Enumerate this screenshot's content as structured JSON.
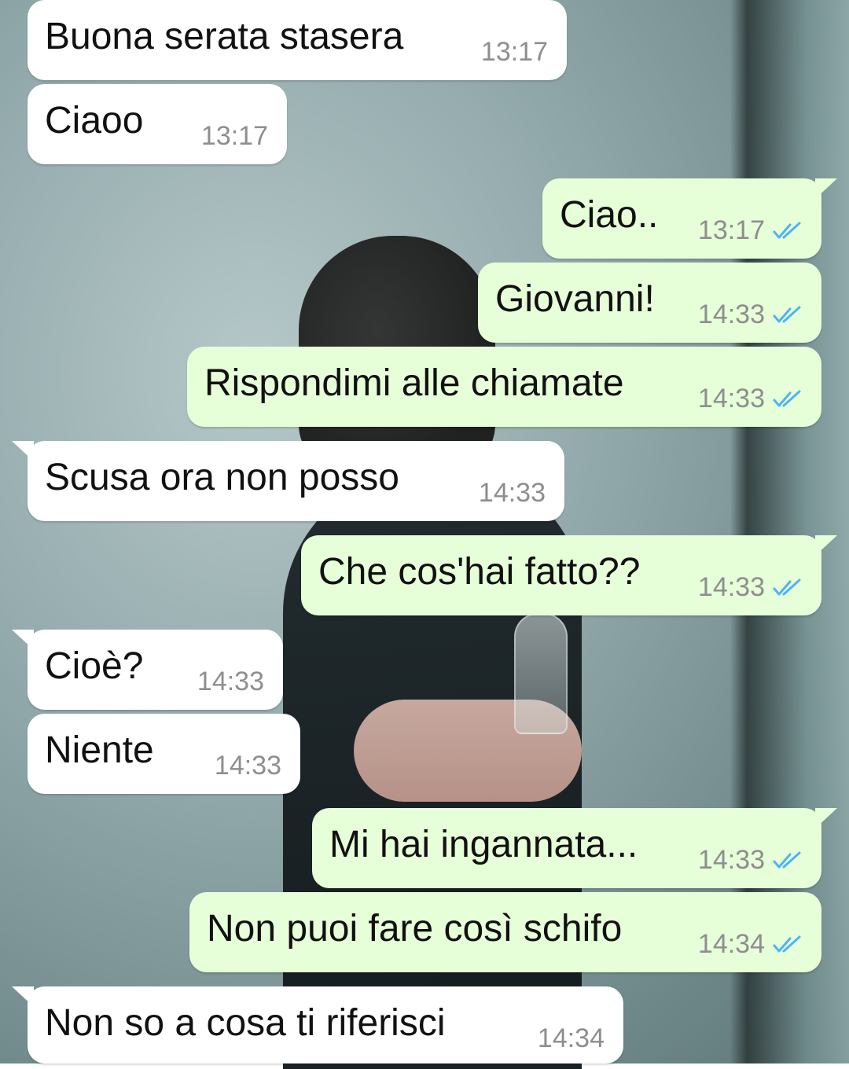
{
  "chat": {
    "messages": [
      {
        "direction": "in",
        "text": "Buona serata stasera",
        "time": "13:17"
      },
      {
        "direction": "in",
        "text": "Ciaoo",
        "time": "13:17"
      },
      {
        "direction": "out",
        "text": "Ciao..",
        "time": "13:17",
        "status_icon": "double-check-read-icon"
      },
      {
        "direction": "out",
        "text": "Giovanni!",
        "time": "14:33",
        "status_icon": "double-check-read-icon"
      },
      {
        "direction": "out",
        "text": "Rispondimi alle chiamate",
        "time": "14:33",
        "status_icon": "double-check-read-icon"
      },
      {
        "direction": "in",
        "text": "Scusa ora non posso",
        "time": "14:33"
      },
      {
        "direction": "out",
        "text": "Che cos'hai fatto??",
        "time": "14:33",
        "status_icon": "double-check-read-icon"
      },
      {
        "direction": "in",
        "text": "Cioè?",
        "time": "14:33"
      },
      {
        "direction": "in",
        "text": "Niente",
        "time": "14:33"
      },
      {
        "direction": "out",
        "text": "Mi hai ingannata...",
        "time": "14:33",
        "status_icon": "double-check-read-icon"
      },
      {
        "direction": "out",
        "text": "Non puoi fare così schifo",
        "time": "14:34",
        "status_icon": "double-check-read-icon"
      },
      {
        "direction": "in",
        "text": "Non so a cosa ti riferisci",
        "time": "14:34"
      }
    ]
  },
  "colors": {
    "incoming_bubble": "#ffffff",
    "outgoing_bubble": "#e7ffd8",
    "read_ticks": "#4fb3f6",
    "timestamp": "#8e8e8e"
  }
}
